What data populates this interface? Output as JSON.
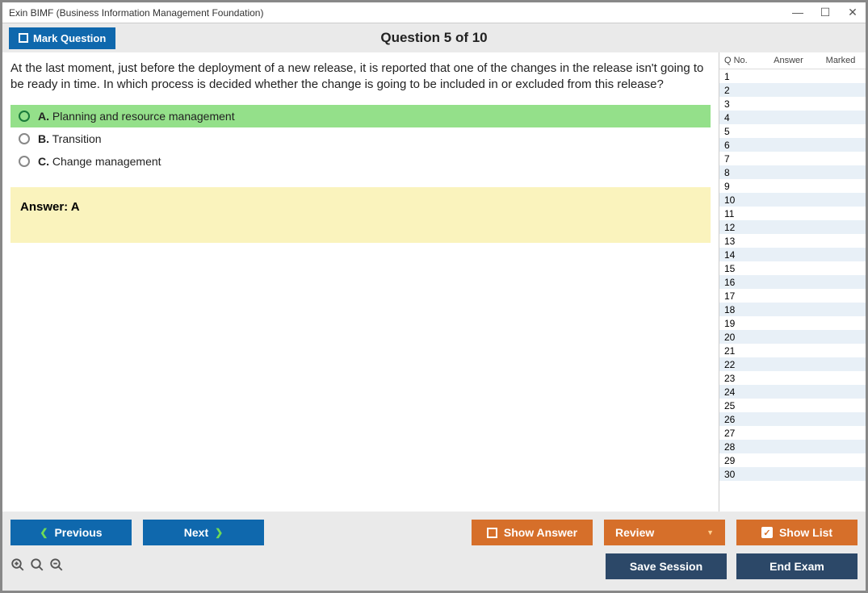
{
  "window_title": "Exin BIMF (Business Information Management Foundation)",
  "header": {
    "mark_label": "Mark Question",
    "question_title": "Question 5 of 10"
  },
  "question_text": "At the last moment, just before the deployment of a new release, it is reported that one of the changes in the release isn't going to be ready in time. In which process is decided whether the change is going to be included in or excluded from this release?",
  "options": [
    {
      "letter": "A.",
      "text": "Planning and resource management",
      "selected": true
    },
    {
      "letter": "B.",
      "text": "Transition",
      "selected": false
    },
    {
      "letter": "C.",
      "text": "Change management",
      "selected": false
    }
  ],
  "answer_label": "Answer: A",
  "sidebar": {
    "col1": "Q No.",
    "col2": "Answer",
    "col3": "Marked",
    "rows": [
      1,
      2,
      3,
      4,
      5,
      6,
      7,
      8,
      9,
      10,
      11,
      12,
      13,
      14,
      15,
      16,
      17,
      18,
      19,
      20,
      21,
      22,
      23,
      24,
      25,
      26,
      27,
      28,
      29,
      30
    ]
  },
  "buttons": {
    "previous": "Previous",
    "next": "Next",
    "show_answer": "Show Answer",
    "review": "Review",
    "show_list": "Show List",
    "save_session": "Save Session",
    "end_exam": "End Exam"
  }
}
